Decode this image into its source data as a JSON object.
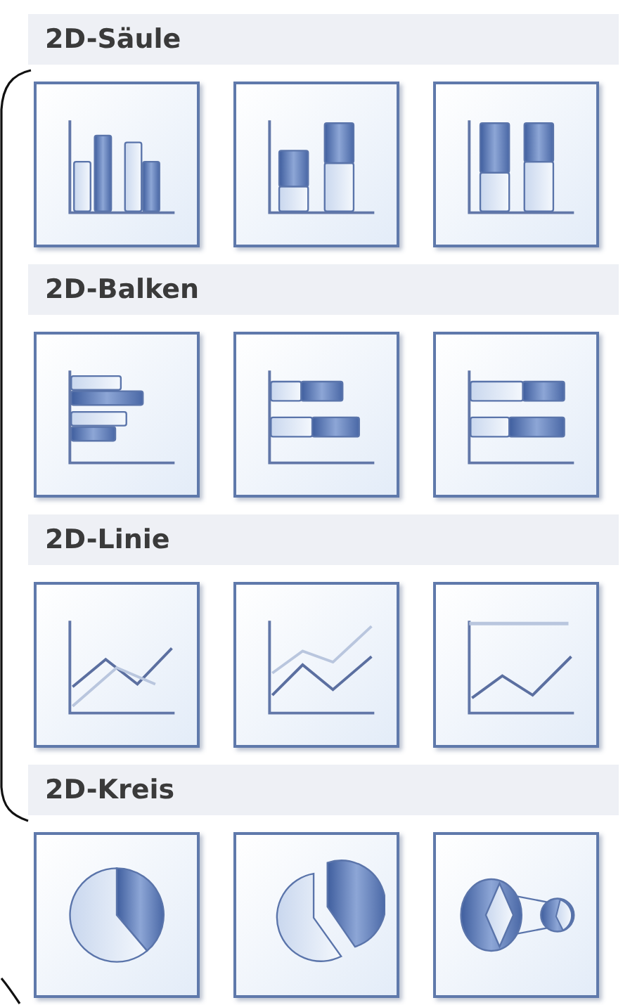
{
  "sections": [
    {
      "title": "2D-Säule",
      "options": [
        {
          "kind": "columnclustered"
        },
        {
          "kind": "columnstacked"
        },
        {
          "kind": "columnfull"
        }
      ]
    },
    {
      "title": "2D-Balken",
      "options": [
        {
          "kind": "barclustered"
        },
        {
          "kind": "barstacked"
        },
        {
          "kind": "barfull"
        }
      ]
    },
    {
      "title": "2D-Linie",
      "options": [
        {
          "kind": "line"
        },
        {
          "kind": "linestacked"
        },
        {
          "kind": "linefull"
        }
      ]
    },
    {
      "title": "2D-Kreis",
      "options": [
        {
          "kind": "pie"
        },
        {
          "kind": "pieexploded"
        },
        {
          "kind": "pieofpie"
        }
      ]
    }
  ]
}
